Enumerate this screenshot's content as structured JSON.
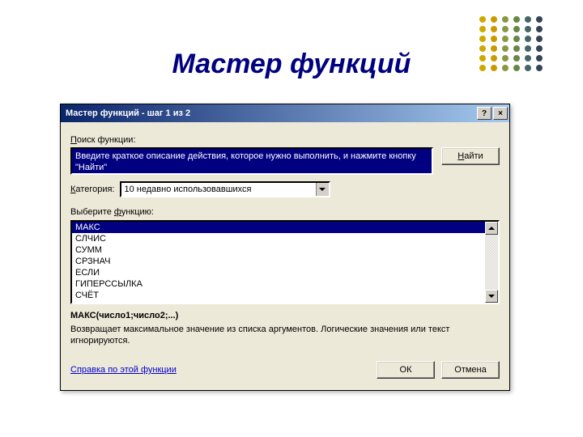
{
  "slide_title": "Мастер функций",
  "deco_colors": [
    "#ccaa00",
    "#cc9900",
    "#889944",
    "#668844",
    "#446666",
    "#334455"
  ],
  "dialog": {
    "title": "Мастер функций - шаг 1 из 2",
    "help_btn": "?",
    "close_btn": "×",
    "search_label_pre": "П",
    "search_label_post": "оиск функции:",
    "search_text": "Введите краткое описание действия, которое нужно выполнить, и нажмите кнопку \"Найти\"",
    "find_pre": "Н",
    "find_post": "айти",
    "category_label_pre": "К",
    "category_label_post": "атегория:",
    "category_value": "10 недавно использовавшихся",
    "select_label_pre": "Выберите ",
    "select_label_u": "ф",
    "select_label_post": "ункцию:",
    "functions": [
      "МАКС",
      "СЛЧИС",
      "СУММ",
      "СРЗНАЧ",
      "ЕСЛИ",
      "ГИПЕРССЫЛКА",
      "СЧЁТ"
    ],
    "selected_index": 0,
    "syntax_name": "МАКС",
    "syntax_args": "(число1;число2;...)",
    "description": "Возвращает максимальное значение из списка аргументов. Логические значения или текст игнорируются.",
    "help_link": "Справка по этой функции",
    "ok": "ОК",
    "cancel": "Отмена"
  }
}
